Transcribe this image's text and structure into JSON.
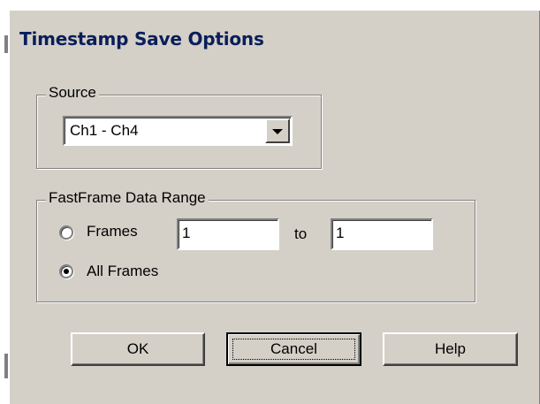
{
  "dialog": {
    "title": "Timestamp Save Options"
  },
  "source_group": {
    "legend": "Source",
    "combo": {
      "selected": "Ch1 - Ch4",
      "icon": "chevron-down-icon"
    }
  },
  "range_group": {
    "legend": "FastFrame Data Range",
    "frames_radio": {
      "label": "Frames",
      "checked": false
    },
    "from_value": "1",
    "to_label": "to",
    "to_value": "1",
    "all_frames_radio": {
      "label": "All Frames",
      "checked": true
    }
  },
  "buttons": {
    "ok": "OK",
    "cancel": "Cancel",
    "help": "Help"
  },
  "colors": {
    "face": "#d4d0c8",
    "title": "#0a1e5a"
  }
}
